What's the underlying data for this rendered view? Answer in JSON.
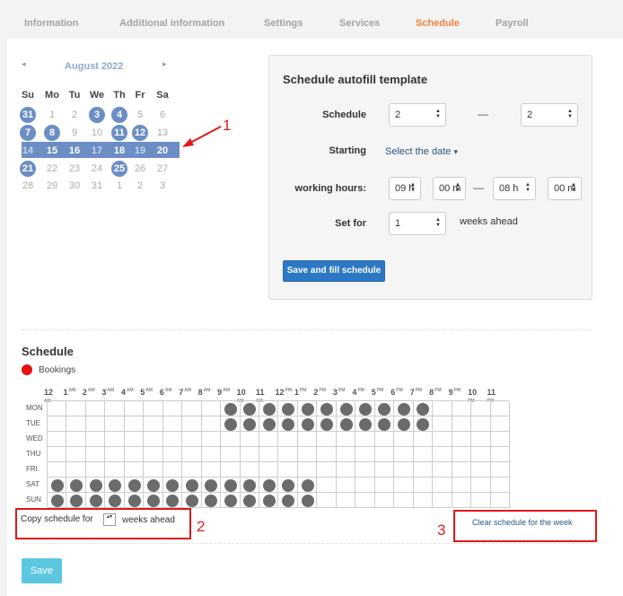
{
  "tabs": [
    "Information",
    "Additional information",
    "Settings",
    "Services",
    "Schedule",
    "Payroll"
  ],
  "calendar": {
    "month_title": "August 2022",
    "prev": "◂",
    "next": "▸",
    "weekdays": [
      "Su",
      "Mo",
      "Tu",
      "We",
      "Th",
      "Fr",
      "Sa"
    ],
    "weeks": [
      [
        "31",
        "1",
        "2",
        "3",
        "4",
        "5",
        "6"
      ],
      [
        "7",
        "8",
        "9",
        "10",
        "11",
        "12",
        "13"
      ],
      [
        "14",
        "15",
        "16",
        "17",
        "18",
        "19",
        "20"
      ],
      [
        "21",
        "22",
        "23",
        "24",
        "25",
        "26",
        "27"
      ],
      [
        "28",
        "29",
        "30",
        "31",
        "1",
        "2",
        "3"
      ]
    ]
  },
  "annotations": {
    "one": "1",
    "two": "2",
    "three": "3"
  },
  "template": {
    "title": "Schedule autofill template",
    "schedule_label": "Schedule",
    "schedule_from": "2",
    "schedule_to": "2",
    "dash": "—",
    "starting_label": "Starting",
    "select_date": "Select the date",
    "caret": "▾",
    "working_hours_label": "working hours:",
    "start_hour": "09 h",
    "start_min": "00 m",
    "end_hour": "08 h",
    "end_min": "00 m",
    "set_for_label": "Set for",
    "weeks_value": "1",
    "weeks_ahead": "weeks ahead",
    "save_fill_button": "Save and fill schedule"
  },
  "schedule": {
    "title": "Schedule",
    "legend": "Bookings",
    "hours": [
      {
        "h": "12",
        "ap": "AM",
        "below": true
      },
      {
        "h": "1",
        "ap": "AM"
      },
      {
        "h": "2",
        "ap": "AM"
      },
      {
        "h": "3",
        "ap": "AM"
      },
      {
        "h": "4",
        "ap": "AM"
      },
      {
        "h": "5",
        "ap": "AM"
      },
      {
        "h": "6",
        "ap": "AM"
      },
      {
        "h": "7",
        "ap": "AM"
      },
      {
        "h": "8",
        "ap": "AM"
      },
      {
        "h": "9",
        "ap": "AM"
      },
      {
        "h": "10",
        "ap": "AM",
        "below": true
      },
      {
        "h": "11",
        "ap": "AM",
        "below": true
      },
      {
        "h": "12",
        "ap": "PM"
      },
      {
        "h": "1",
        "ap": "PM"
      },
      {
        "h": "2",
        "ap": "PM"
      },
      {
        "h": "3",
        "ap": "PM"
      },
      {
        "h": "4",
        "ap": "PM"
      },
      {
        "h": "5",
        "ap": "PM"
      },
      {
        "h": "6",
        "ap": "PM"
      },
      {
        "h": "7",
        "ap": "PM"
      },
      {
        "h": "8",
        "ap": "PM"
      },
      {
        "h": "9",
        "ap": "PM"
      },
      {
        "h": "10",
        "ap": "PM",
        "below": true
      },
      {
        "h": "11",
        "ap": "PM",
        "below": true
      }
    ],
    "days": [
      "MON",
      "TUE",
      "WED",
      "THU",
      "FRI",
      "SAT",
      "SUN"
    ],
    "bookings": {
      "MON": [
        9,
        10,
        11,
        12,
        13,
        14,
        15,
        16,
        17,
        18,
        19
      ],
      "TUE": [
        9,
        10,
        11,
        12,
        13,
        14,
        15,
        16,
        17,
        18,
        19
      ],
      "WED": [],
      "THU": [],
      "FRI": [],
      "SAT": [
        0,
        1,
        2,
        3,
        4,
        5,
        6,
        7,
        8,
        9,
        10,
        11,
        12,
        13
      ],
      "SUN": [
        0,
        1,
        2,
        3,
        4,
        5,
        6,
        7,
        8,
        9,
        10,
        11,
        12,
        13
      ]
    },
    "copy_prefix": "Copy schedule for",
    "copy_value": "▴▾",
    "copy_suffix": "weeks ahead",
    "clear_link": "Clear schedule for the week"
  },
  "save_button": "Save"
}
